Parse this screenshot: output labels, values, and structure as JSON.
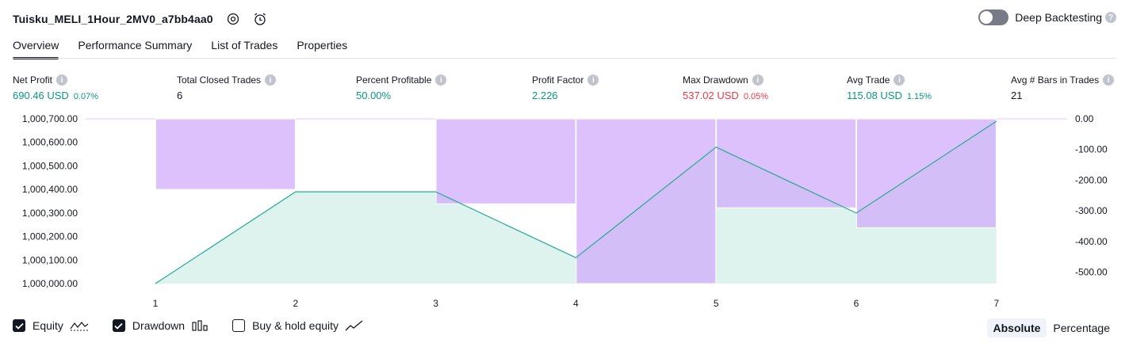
{
  "header": {
    "strategy_name": "Tuisku_MELI_1Hour_2MV0_a7bb4aa0",
    "icons": [
      "settings-icon",
      "alarm-icon"
    ],
    "deep_backtesting_label": "Deep Backtesting",
    "deep_backtesting_enabled": false
  },
  "tabs": [
    {
      "label": "Overview",
      "active": true
    },
    {
      "label": "Performance Summary",
      "active": false
    },
    {
      "label": "List of Trades",
      "active": false
    },
    {
      "label": "Properties",
      "active": false
    }
  ],
  "metrics": {
    "net_profit": {
      "label": "Net Profit",
      "value": "690.46 USD",
      "pct": "0.07%"
    },
    "total_closed_trades": {
      "label": "Total Closed Trades",
      "value": "6"
    },
    "percent_profitable": {
      "label": "Percent Profitable",
      "value": "50.00%"
    },
    "profit_factor": {
      "label": "Profit Factor",
      "value": "2.226"
    },
    "max_drawdown": {
      "label": "Max Drawdown",
      "value": "537.02 USD",
      "pct": "0.05%"
    },
    "avg_trade": {
      "label": "Avg Trade",
      "value": "115.08 USD",
      "pct": "1.15%"
    },
    "avg_bars": {
      "label": "Avg # Bars in Trades",
      "value": "21"
    }
  },
  "colors": {
    "green": "#089981",
    "red": "#f23645",
    "equity_line": "#22ab94",
    "equity_fill": "#d8f1eb",
    "drawdown_fill": "#cfa6fb"
  },
  "chart_data": {
    "type": "area",
    "x": [
      1,
      2,
      3,
      4,
      5,
      6,
      7
    ],
    "left_axis_ticks": [
      "1,000,700.00",
      "1,000,600.00",
      "1,000,500.00",
      "1,000,400.00",
      "1,000,300.00",
      "1,000,200.00",
      "1,000,100.00",
      "1,000,000.00"
    ],
    "right_axis_ticks": [
      "0.00",
      "-100.00",
      "-200.00",
      "-300.00",
      "-400.00",
      "-500.00"
    ],
    "left_ylim": [
      1000000,
      1000700
    ],
    "right_ylim": [
      -537.02,
      0
    ],
    "series": [
      {
        "name": "Equity",
        "axis": "left",
        "values": [
          1000000,
          1000390,
          1000390,
          1000110,
          1000580,
          1000300,
          1000690
        ]
      },
      {
        "name": "Drawdown",
        "axis": "right",
        "type": "bar",
        "x": [
          1.5,
          3.5,
          4.5,
          5.5,
          6.5
        ],
        "values": [
          -230,
          -277,
          -537.02,
          -290,
          -355
        ]
      }
    ]
  },
  "legend": {
    "equity": {
      "label": "Equity",
      "checked": true
    },
    "drawdown": {
      "label": "Drawdown",
      "checked": true
    },
    "buy_hold": {
      "label": "Buy & hold equity",
      "checked": false
    }
  },
  "modes": {
    "absolute": "Absolute",
    "percentage": "Percentage",
    "active": "absolute"
  }
}
